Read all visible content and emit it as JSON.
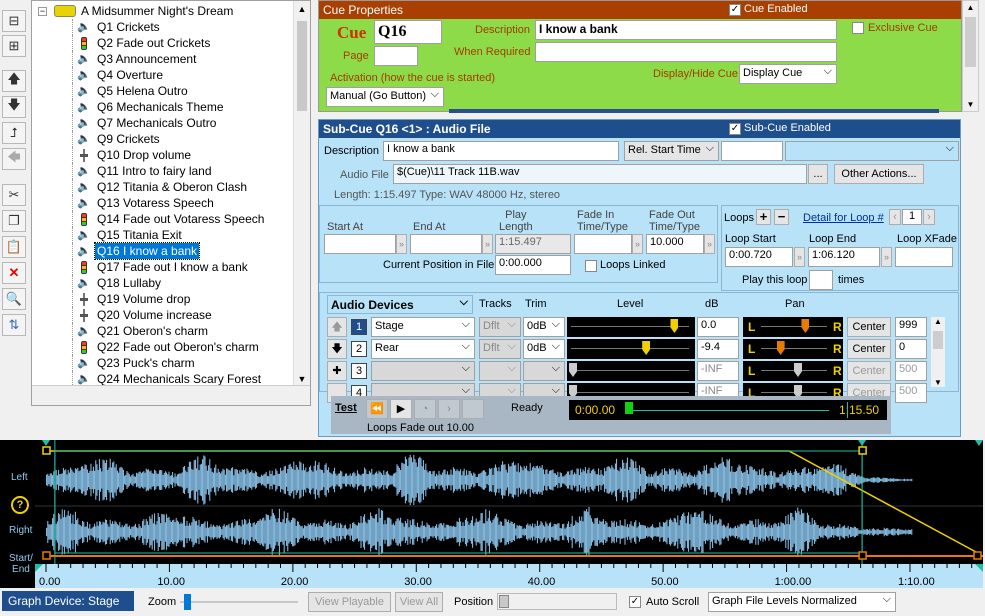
{
  "tree": {
    "root": "A Midsummer Night's Dream",
    "items": [
      {
        "label": "Q1 Crickets",
        "icon": "speaker-icon"
      },
      {
        "label": "Q2 Fade out Crickets",
        "icon": "traffic-light-icon"
      },
      {
        "label": "Q3 Announcement",
        "icon": "speaker-icon"
      },
      {
        "label": "Q4 Overture",
        "icon": "speaker-icon"
      },
      {
        "label": "Q5 Helena Outro",
        "icon": "speaker-icon"
      },
      {
        "label": "Q6 Mechanicals Theme",
        "icon": "speaker-icon"
      },
      {
        "label": "Q7 Mechanicals Outro",
        "icon": "speaker-icon"
      },
      {
        "label": "Q9 Crickets",
        "icon": "speaker-icon"
      },
      {
        "label": "Q10 Drop volume",
        "icon": "fader-icon"
      },
      {
        "label": "Q11 Intro to fairy land",
        "icon": "speaker-icon"
      },
      {
        "label": "Q12 Titania & Oberon Clash",
        "icon": "speaker-icon"
      },
      {
        "label": "Q13 Votaress Speech",
        "icon": "speaker-icon"
      },
      {
        "label": "Q14 Fade out Votaress Speech",
        "icon": "traffic-light-icon"
      },
      {
        "label": "Q15 Titania Exit",
        "icon": "speaker-icon"
      },
      {
        "label": "Q16 I know a bank",
        "icon": "speaker-icon"
      },
      {
        "label": "Q17 Fade out I know a bank",
        "icon": "traffic-light-icon"
      },
      {
        "label": "Q18 Lullaby",
        "icon": "speaker-icon"
      },
      {
        "label": "Q19 Volume drop",
        "icon": "fader-icon"
      },
      {
        "label": "Q20 Volume increase",
        "icon": "fader-icon"
      },
      {
        "label": "Q21 Oberon's charm",
        "icon": "speaker-icon"
      },
      {
        "label": "Q22 Fade out Oberon's charm",
        "icon": "traffic-light-icon"
      },
      {
        "label": "Q23 Puck's charm",
        "icon": "speaker-icon"
      },
      {
        "label": "Q24 Mechanicals Scary Forest",
        "icon": "speaker-icon"
      }
    ]
  },
  "cue_props": {
    "header": "Cue Properties",
    "cue_enabled": "Cue Enabled",
    "cue_label": "Cue",
    "cue_value": "Q16",
    "page_label": "Page",
    "page_value": "",
    "description_label": "Description",
    "description_value": "I know a bank",
    "when_required_label": "When Required",
    "when_required_value": "",
    "exclusive_label": "Exclusive Cue",
    "activation_label": "Activation (how the cue is started)",
    "activation_value": "Manual (Go Button)",
    "display_hide_label": "Display/Hide Cue",
    "display_hide_value": "Display Cue"
  },
  "subcue": {
    "header": "Sub-Cue Q16 <1> : Audio File",
    "enabled_label": "Sub-Cue Enabled",
    "description_label": "Description",
    "description_value": "I know a bank",
    "rel_start_label": "Rel. Start Time",
    "audio_file_label": "Audio File",
    "audio_file_value": "$(Cue)\\11 Track 11B.wav",
    "browse_label": "...",
    "other_actions_label": "Other Actions...",
    "length_info": "Length: 1:15.497  Type: WAV 48000 Hz, stereo",
    "start_at_label": "Start At",
    "end_at_label": "End At",
    "play_length_label": "Play\nLength",
    "play_length_value": "1:15.497",
    "fade_in_label": "Fade In\nTime/Type",
    "fade_out_label": "Fade Out\nTime/Type",
    "fade_out_value": "10.000",
    "current_pos_label": "Current Position in File",
    "current_pos_value": "0:00.000",
    "loops_linked_label": "Loops Linked",
    "loops_label": "Loops",
    "detail_for_loop_label": "Detail for Loop #",
    "loop_number": "1",
    "loop_start_label": "Loop Start",
    "loop_start_value": "0:00.720",
    "loop_end_label": "Loop End",
    "loop_end_value": "1:06.120",
    "loop_xfade_label": "Loop XFade",
    "play_this_loop_label": "Play this loop",
    "times_label": "times"
  },
  "devices": {
    "header": "Audio Devices",
    "tracks_label": "Tracks",
    "trim_label": "Trim",
    "level_label": "Level",
    "db_label": "dB",
    "pan_label": "Pan",
    "rows": [
      {
        "num": "1",
        "device": "Stage",
        "tracks": "Dflt",
        "trim": "0dB",
        "db": "0.0",
        "level": 0.86,
        "pan_label": "Center",
        "pan": 0.62,
        "val": "999"
      },
      {
        "num": "2",
        "device": "Rear",
        "tracks": "Dflt",
        "trim": "0dB",
        "db": "-9.4",
        "level": 0.62,
        "pan_label": "Center",
        "pan": 0.22,
        "val": "0"
      },
      {
        "num": "3",
        "device": "",
        "tracks": "",
        "trim": "",
        "db": "-INF",
        "level": 0.0,
        "pan_label": "Center",
        "pan": 0.5,
        "val": "500"
      },
      {
        "num": "4",
        "device": "",
        "tracks": "",
        "trim": "",
        "db": "-INF",
        "level": 0.0,
        "pan_label": "Center",
        "pan": 0.5,
        "val": "500"
      }
    ],
    "l_label": "L",
    "r_label": "R"
  },
  "transport": {
    "test_label": "Test",
    "status": "Ready",
    "time_start": "0:00.00",
    "time_end": "1:15.50",
    "loops_info": "Loops  Fade out 10.00"
  },
  "graph": {
    "left_label": "Left",
    "right_label": "Right",
    "startend_label": "Start/\nEnd",
    "help_label": "?",
    "ticks": [
      "0.00",
      "10.00",
      "20.00",
      "30.00",
      "40.00",
      "50.00",
      "1:00.00",
      "1:10.00"
    ],
    "device_label": "Graph Device: Stage",
    "zoom_label": "Zoom",
    "view_playable": "View Playable",
    "view_all": "View All",
    "position_label": "Position",
    "auto_scroll_label": "Auto Scroll",
    "levels_value": "Graph File Levels Normalized"
  },
  "colors": {
    "green_panel": "#8edb4a",
    "blue_panel": "#b7e2f8",
    "header_blue": "#1f4e8c",
    "waveform": "#8ec9f0",
    "cue_red": "#cc3300"
  }
}
